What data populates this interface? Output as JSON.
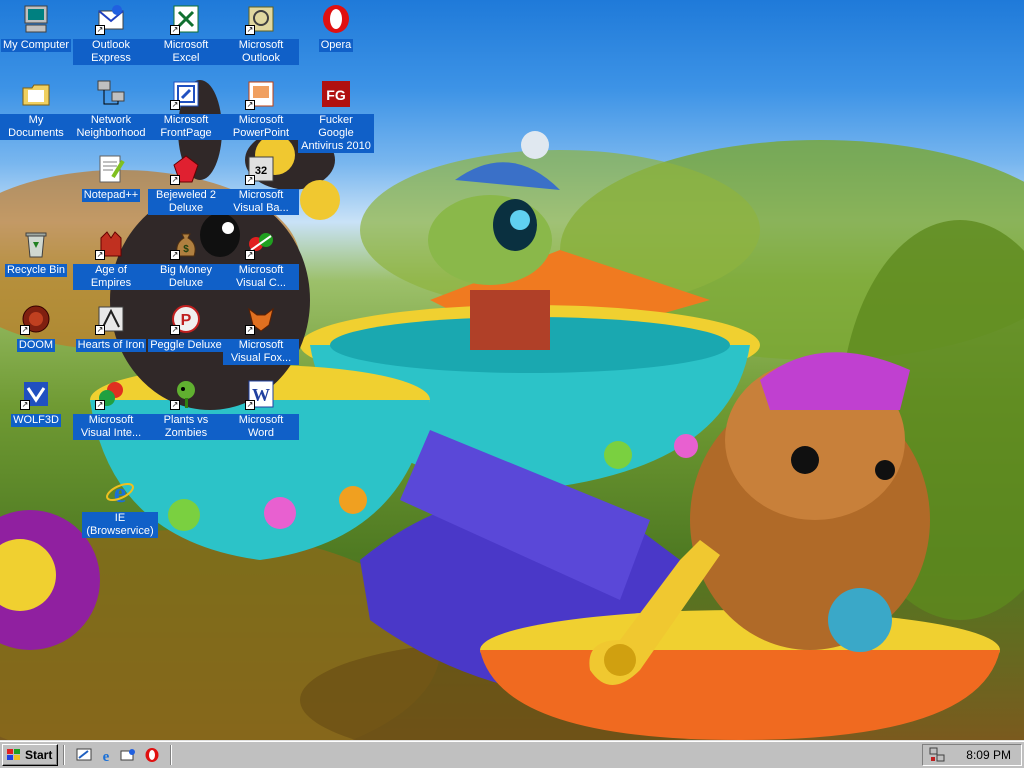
{
  "desktop": {
    "icons": [
      {
        "label": "My Computer"
      },
      {
        "label": "Outlook Express"
      },
      {
        "label": "Microsoft Excel"
      },
      {
        "label": "Microsoft Outlook"
      },
      {
        "label": "Opera"
      },
      {
        "label": "My Documents"
      },
      {
        "label": "Network Neighborhood"
      },
      {
        "label": "Microsoft FrontPage"
      },
      {
        "label": "Microsoft PowerPoint"
      },
      {
        "label": "Fucker Google Antivirus 2010"
      },
      {
        "label": "Notepad++"
      },
      {
        "label": "Bejeweled 2 Deluxe"
      },
      {
        "label": "Microsoft Visual Ba..."
      },
      {
        "label": "Recycle Bin"
      },
      {
        "label": "Age of Empires"
      },
      {
        "label": "Big Money Deluxe"
      },
      {
        "label": "Microsoft Visual C..."
      },
      {
        "label": "DOOM"
      },
      {
        "label": "Hearts of Iron"
      },
      {
        "label": "Peggle Deluxe"
      },
      {
        "label": "Microsoft Visual Fox..."
      },
      {
        "label": "WOLF3D"
      },
      {
        "label": "Microsoft Visual Inte..."
      },
      {
        "label": "Plants vs Zombies"
      },
      {
        "label": "Microsoft Word"
      },
      {
        "label": "IE (Browservice)"
      }
    ]
  },
  "taskbar": {
    "start_label": "Start",
    "quick_launch": [
      "show-desktop-icon",
      "ie-icon",
      "outlook-express-icon",
      "opera-icon"
    ],
    "clock": "8:09 PM"
  },
  "colors": {
    "selection_blue": "#1060c8",
    "taskbar_gray": "#c0c0c0"
  }
}
